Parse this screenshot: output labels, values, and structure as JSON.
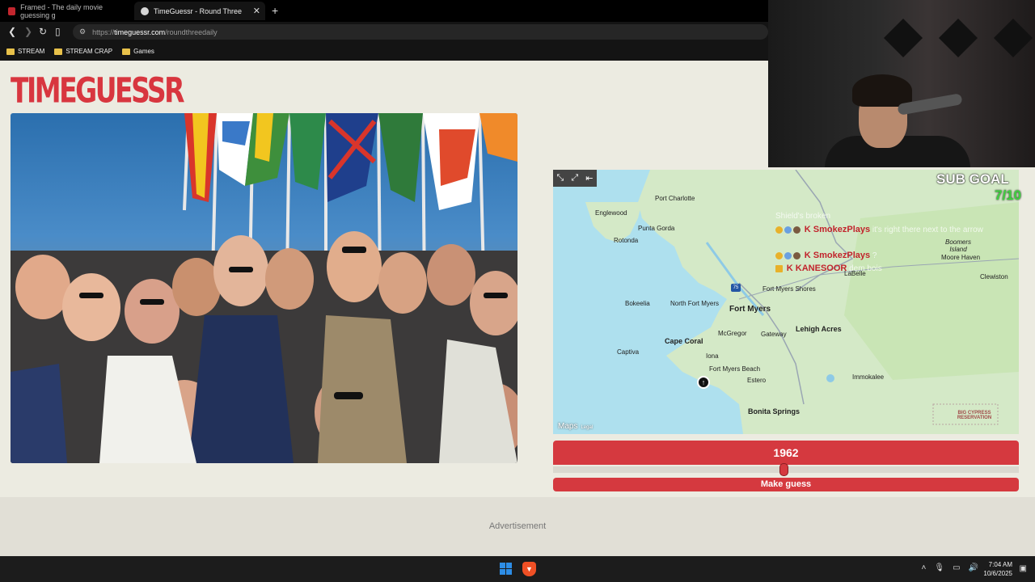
{
  "browser": {
    "tabs": [
      {
        "title": "Framed - The daily movie guessing g",
        "active": false
      },
      {
        "title": "TimeGuessr - Round Three",
        "active": true
      }
    ],
    "url_prefix": "https://",
    "url_host": "timeguessr.com",
    "url_path": "/roundthreedaily",
    "bookmarks": [
      "STREAM",
      "STREAM CRAP",
      "Games"
    ]
  },
  "page": {
    "logo": "TIMEGUESSR",
    "year": "1962",
    "year_slider_fraction": 0.5,
    "make_guess_label": "Make guess",
    "advertisement_label": "Advertisement"
  },
  "map": {
    "places": [
      "Port Charlotte",
      "Englewood",
      "Punta Gorda",
      "Rotonda",
      "Boomers Island",
      "Moore Haven",
      "LaBelle",
      "Clewiston",
      "Fort Myers Shores",
      "Bokeelia",
      "North Fort Myers",
      "Fort Myers",
      "Lehigh Acres",
      "McGregor",
      "Gateway",
      "Cape Coral",
      "Captiva",
      "Iona",
      "Fort Myers Beach",
      "Estero",
      "Immokalee",
      "Bonita Springs",
      "BIG CYPRESS RESERVATION"
    ],
    "highway_label": "75",
    "attribution": "Maps",
    "legal": "Legal"
  },
  "stream_overlay": {
    "sub_goal_label": "SUB GOAL",
    "sub_goal_count": "7/10",
    "chat": [
      {
        "user": "",
        "text": "Shield's broken"
      },
      {
        "user": "K SmokezPlays",
        "text": "it's right there next to the arrow"
      },
      {
        "user": "K SmokezPlays",
        "text": "?"
      },
      {
        "user": "K KANESOOR",
        "text": "dem bois"
      }
    ]
  },
  "taskbar": {
    "time": "7:04 AM",
    "date": "10/6/2025"
  }
}
